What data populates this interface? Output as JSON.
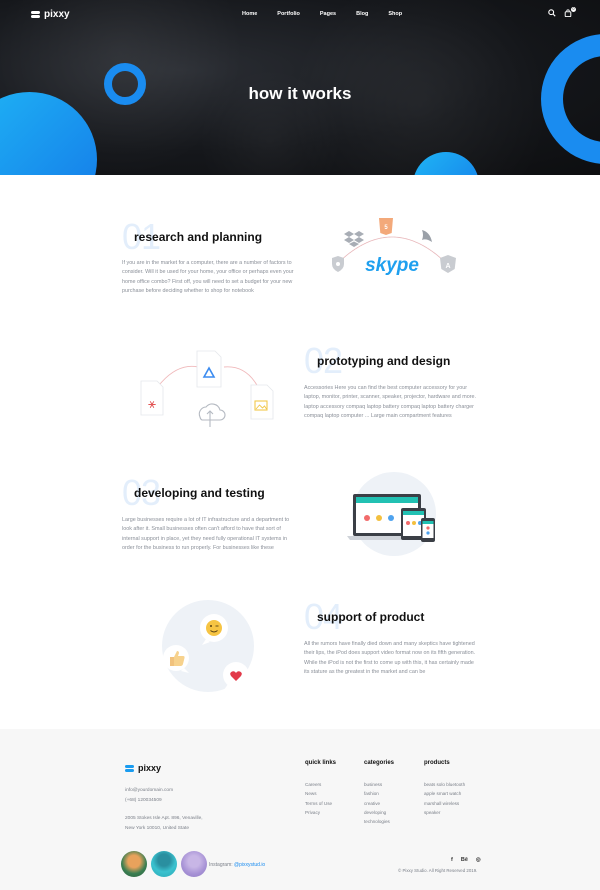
{
  "brand": {
    "name": "pixxy"
  },
  "nav": {
    "items": [
      "Home",
      "Portfolio",
      "Pages",
      "Blog",
      "Shop"
    ],
    "search_icon": "search-icon",
    "cart_icon": "cart-icon",
    "cart_count": "0"
  },
  "hero": {
    "title": "how it works"
  },
  "steps": [
    {
      "number": "01",
      "title": "research and planning",
      "text": "If you are in the market for a computer, there are a number of factors to consider. Will it be used for your home, your office or perhaps even your home office combo? First off, you will need to set a budget for your new purchase before deciding whether to shop for notebook",
      "logo_text": "skype"
    },
    {
      "number": "02",
      "title": "prototyping and design",
      "text": "Accessories Here you can find the best computer accessory for your laptop, monitor, printer, scanner, speaker, projector, hardware and more. laptop accessory compaq laptop battery compaq laptop battery charger compaq laptop computer ... Large main compartment features"
    },
    {
      "number": "03",
      "title": "developing and testing",
      "text": "Large businesses require a lot of IT infrastructure and a department to look after it. Small businesses often can't afford to have that sort of internal support in place, yet they need fully operational IT systems in order for the business to run properly. For businesses like these"
    },
    {
      "number": "04",
      "title": "support of product",
      "text": "All the rumors have finally died down and many skeptics have tightened their lips, the iPod does support video format now on its fifth generation. While the iPod is not the first to come up with this, it has certainly made its stature as the greatest in the market and can be"
    }
  ],
  "footer": {
    "email": "info@yourdomain.com",
    "phone": "(+68) 120034509",
    "address_line1": "2005 Stokes Isle Apt. 896, Venaville,",
    "address_line2": "New York 10010, United State",
    "columns": [
      {
        "heading": "quick links",
        "items": [
          "Careers",
          "News",
          "Terms of Use",
          "Privacy"
        ]
      },
      {
        "heading": "categories",
        "items": [
          "business",
          "fashion",
          "creative",
          "developing",
          "technologies"
        ]
      },
      {
        "heading": "products",
        "items": [
          "beats solo bluetooth",
          "apple smart watch",
          "marshall wireless",
          "speaker"
        ]
      }
    ],
    "instagram_label": "Instagram:",
    "instagram_handle": "@pixxystud.io",
    "socials": [
      "f",
      "Bē",
      "◎"
    ],
    "copyright": "© Pixxy Studio. All Right Reserved 2019."
  },
  "colors": {
    "accent": "#1a8cf0",
    "hero_bg": "#15171b",
    "footer_bg": "#f7f7f7"
  }
}
